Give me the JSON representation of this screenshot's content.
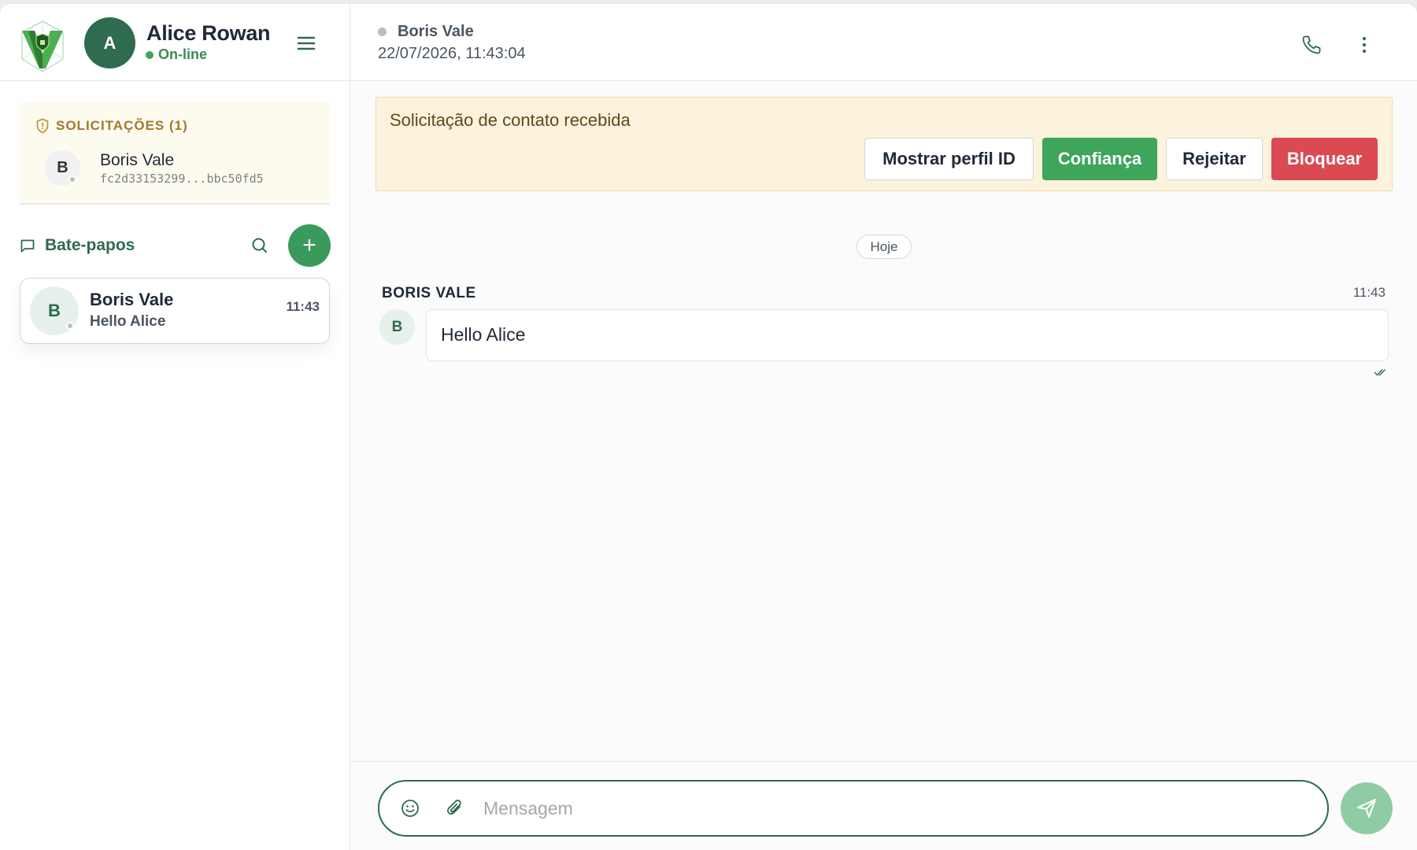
{
  "user": {
    "avatar_initial": "A",
    "name": "Alice Rowan",
    "status": "On-line"
  },
  "requests": {
    "title": "SOLICITAÇÕES (1)",
    "items": [
      {
        "initial": "B",
        "name": "Boris Vale",
        "id": "fc2d33153299...bbc50fd5"
      }
    ]
  },
  "chats": {
    "title": "Bate-papos",
    "add_label": "+",
    "items": [
      {
        "initial": "B",
        "name": "Boris Vale",
        "last_message": "Hello Alice",
        "time": "11:43"
      }
    ]
  },
  "conversation": {
    "peer_name": "Boris Vale",
    "timestamp": "22/07/2026, 11:43:04"
  },
  "banner": {
    "text": "Solicitação de contato recebida",
    "show_profile_label": "Mostrar perfil ID",
    "trust_label": "Confiança",
    "reject_label": "Rejeitar",
    "block_label": "Bloquear"
  },
  "messages": {
    "day_label": "Hoje",
    "items": [
      {
        "sender": "BORIS VALE",
        "initial": "B",
        "time": "11:43",
        "text": "Hello Alice"
      }
    ]
  },
  "composer": {
    "placeholder": "Mensagem"
  },
  "colors": {
    "brand_green": "#2e6b4f",
    "accent_green": "#3ea55b",
    "block_red": "#db4a52",
    "banner_bg": "#fdf3dd"
  },
  "icons": [
    "logo-icon",
    "menu-icon",
    "shield-icon",
    "chat-bubble-icon",
    "search-icon",
    "plus-icon",
    "phone-icon",
    "more-vertical-icon",
    "double-check-icon",
    "emoji-icon",
    "paperclip-icon",
    "send-icon"
  ]
}
